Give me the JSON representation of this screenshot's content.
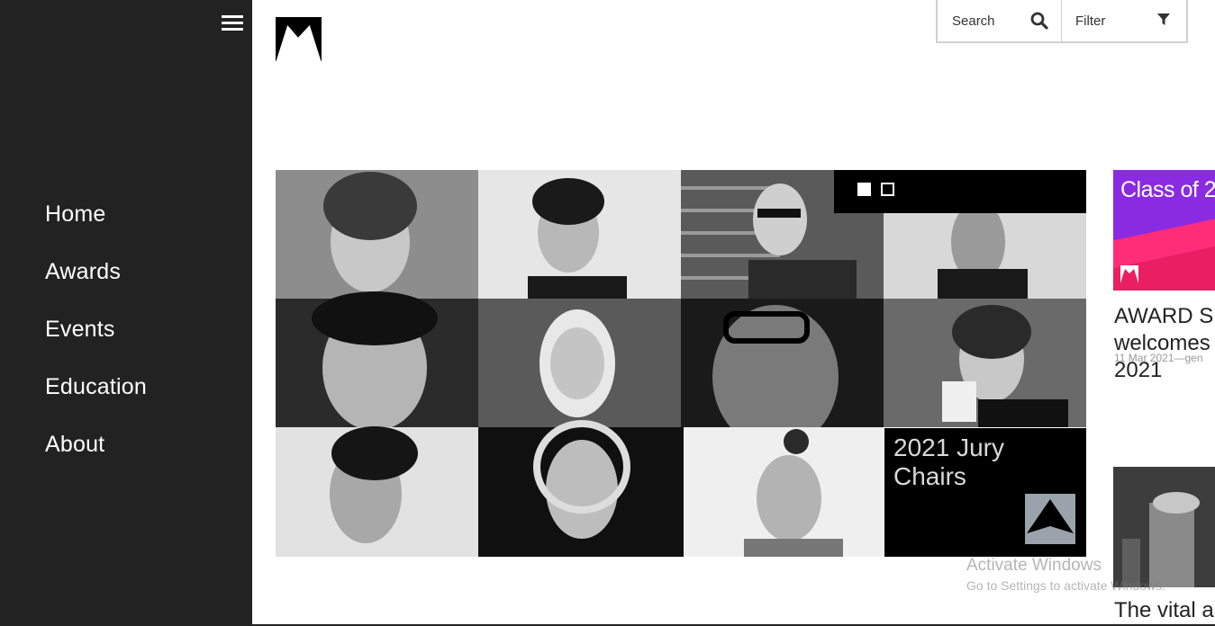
{
  "sidebar": {
    "menu_icon": "hamburger-menu-icon",
    "nav": [
      {
        "label": "Home"
      },
      {
        "label": "Awards"
      },
      {
        "label": "Events"
      },
      {
        "label": "Education"
      },
      {
        "label": "About"
      }
    ]
  },
  "header": {
    "logo_icon": "award-logo-icon",
    "search": {
      "placeholder": "Search",
      "icon": "search-icon"
    },
    "filter": {
      "label": "Filter",
      "icon": "filter-icon"
    }
  },
  "hero": {
    "title": "2021 Jury Chairs",
    "slides": [
      {
        "active": true
      },
      {
        "active": false
      }
    ],
    "portraits": 11
  },
  "news": [
    {
      "image_text": "Class of 2",
      "title": "AWARD S\nwelcomes\n2021",
      "meta": "11 Mar 2021—gen"
    },
    {
      "title": "The vital a"
    }
  ],
  "watermark": {
    "line1": "Activate Windows",
    "line2": "Go to Settings to activate Windows."
  },
  "colors": {
    "sidebar_bg": "#222222",
    "accent_purple": "#8a2be2",
    "accent_pink": "#e91e63"
  }
}
